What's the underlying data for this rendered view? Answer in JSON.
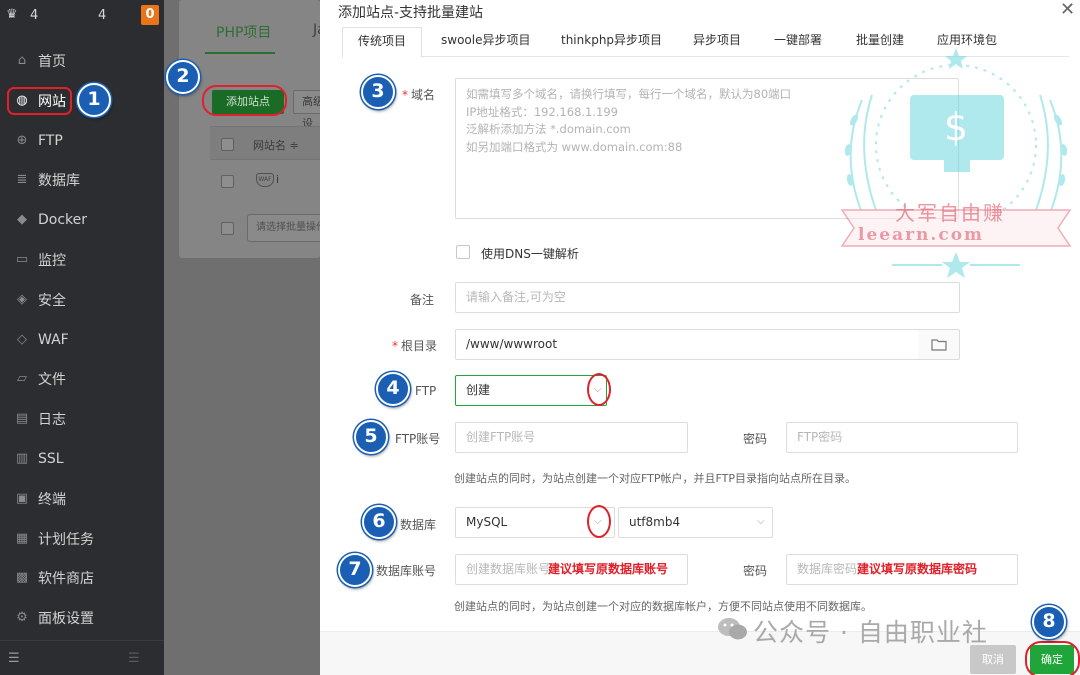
{
  "sidebar": {
    "server_name_left": "4",
    "server_name_right": "4",
    "badge": "0",
    "items": [
      {
        "label": "首页",
        "icon": "home-icon",
        "glyph": "⌂"
      },
      {
        "label": "网站",
        "icon": "globe-icon",
        "glyph": "◍"
      },
      {
        "label": "FTP",
        "icon": "ftp-globe-icon",
        "glyph": "⊕"
      },
      {
        "label": "数据库",
        "icon": "database-icon",
        "glyph": "≣"
      },
      {
        "label": "Docker",
        "icon": "docker-icon",
        "glyph": "◆"
      },
      {
        "label": "监控",
        "icon": "monitor-icon",
        "glyph": "▭"
      },
      {
        "label": "安全",
        "icon": "shield-icon",
        "glyph": "◈"
      },
      {
        "label": "WAF",
        "icon": "waf-shield-icon",
        "glyph": "◇"
      },
      {
        "label": "文件",
        "icon": "folder-icon",
        "glyph": "▱"
      },
      {
        "label": "日志",
        "icon": "log-icon",
        "glyph": "▤"
      },
      {
        "label": "SSL",
        "icon": "ssl-icon",
        "glyph": "▥"
      },
      {
        "label": "终端",
        "icon": "terminal-icon",
        "glyph": "▣"
      },
      {
        "label": "计划任务",
        "icon": "calendar-icon",
        "glyph": "▦"
      },
      {
        "label": "软件商店",
        "icon": "store-icon",
        "glyph": "▩"
      },
      {
        "label": "面板设置",
        "icon": "settings-icon",
        "glyph": "⚙"
      }
    ],
    "active_index": 1
  },
  "background_page": {
    "tab_php": "PHP项目",
    "tab_java": "Java",
    "add_site_button": "添加站点",
    "advanced_button": "高级设",
    "table_header_site": "网站名 ≑",
    "row_icon_text": "WAF",
    "row_text": "i",
    "row_link": "m",
    "batch_placeholder": "请选择批量操作"
  },
  "modal": {
    "title": "添加站点-支持批量建站",
    "tabs": [
      "传统项目",
      "swoole异步项目",
      "thinkphp异步项目",
      "异步项目",
      "一键部署",
      "批量创建",
      "应用环境包"
    ],
    "active_tab": 0,
    "domain_label": "域名",
    "domain_placeholder_lines": [
      "如需填写多个域名，请换行填写，每行一个域名，默认为80端口",
      "IP地址格式：192.168.1.199",
      "泛解析添加方法 *.domain.com",
      "如另加端口格式为 www.domain.com:88"
    ],
    "dns_checkbox_label": "使用DNS一键解析",
    "remark_label": "备注",
    "remark_placeholder": "请输入备注,可为空",
    "root_label": "根目录",
    "root_value": "/www/wwwroot",
    "ftp_label": "FTP",
    "ftp_value": "创建",
    "ftp_account_label": "FTP账号",
    "ftp_account_placeholder": "创建FTP账号",
    "ftp_password_label": "密码",
    "ftp_password_placeholder": "FTP密码",
    "ftp_hint": "创建站点的同时，为站点创建一个对应FTP帐户，并且FTP目录指向站点所在目录。",
    "db_label": "数据库",
    "db_type": "MySQL",
    "db_charset": "utf8mb4",
    "db_account_label": "数据库账号",
    "db_account_placeholder": "创建数据库账号",
    "db_account_note": "建议填写原数据库账号",
    "db_password_label": "密码",
    "db_password_placeholder": "数据库密码",
    "db_password_note": "建议填写原数据库密码",
    "db_hint": "创建站点的同时，为站点创建一个对应的数据库帐户，方便不同站点使用不同数据库。",
    "cancel_button": "取消",
    "ok_button": "确定"
  },
  "markers": [
    "1",
    "2",
    "3",
    "4",
    "5",
    "6",
    "7",
    "8"
  ],
  "watermark": {
    "cn": "大军自由赚",
    "en": "leearn.com",
    "wechat": "公众号 · 自由职业社"
  },
  "colors": {
    "accent": "#20a53a",
    "highlight": "#e0202a",
    "marker": "#1a5fb4",
    "sidebar": "#2c2d30"
  }
}
